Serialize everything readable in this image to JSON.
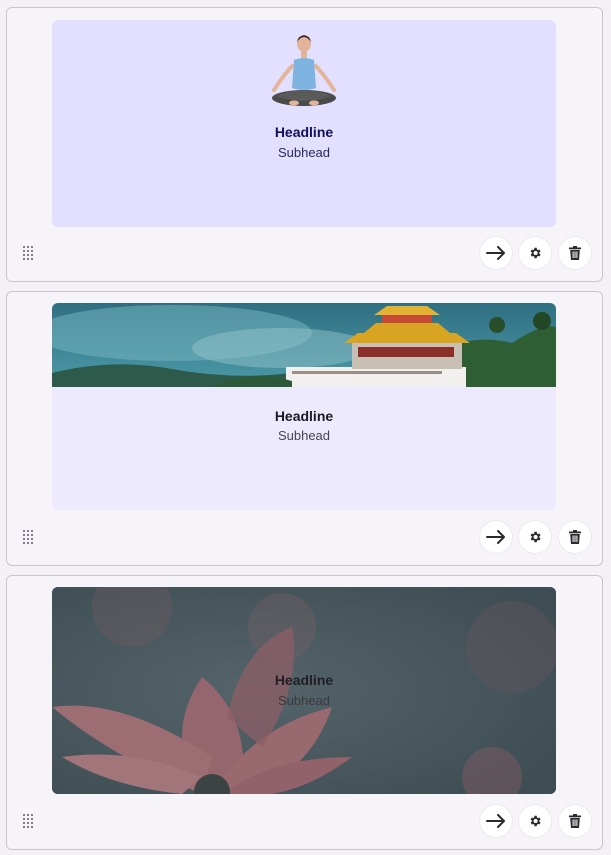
{
  "blocks": [
    {
      "variant": "avatar-top",
      "headline": "Headline",
      "subhead": "Subhead",
      "card_bg": "#e2dfff",
      "headline_color": "#12105a",
      "subhead_color": "#2a2860"
    },
    {
      "variant": "image-top",
      "headline": "Headline",
      "subhead": "Subhead",
      "card_bg": "#eeeafe",
      "headline_color": "#1c1b1f",
      "subhead_color": "#49454f"
    },
    {
      "variant": "image-background",
      "headline": "Headline",
      "subhead": "Subhead",
      "card_bg": "#4a5a60",
      "headline_color": "#1f1f24",
      "subhead_color": "#3a3a40"
    }
  ],
  "icons": {
    "drag": "drag-handle-icon",
    "next": "arrow-right-icon",
    "settings": "gear-icon",
    "delete": "trash-icon"
  }
}
